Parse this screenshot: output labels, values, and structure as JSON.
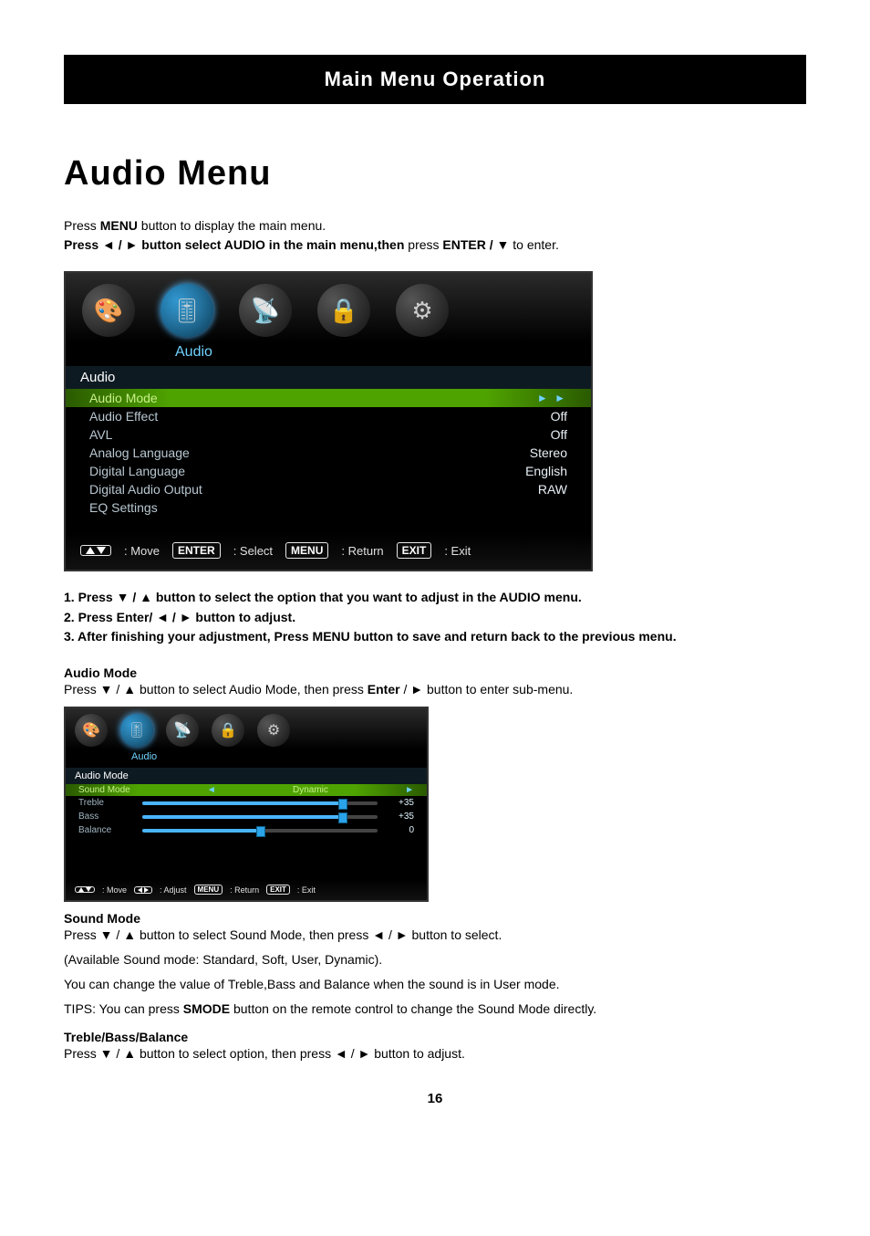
{
  "header": {
    "title": "Main Menu Operation"
  },
  "page_title": "Audio Menu",
  "intro": {
    "line1_pre": "Press ",
    "line1_bold1": "MENU",
    "line1_mid": " button  to display the main menu.",
    "line2_pre": "Press ◄ / ► button select ",
    "line2_bold1": "AUDIO",
    "line2_mid": " in the main menu,then ",
    "line2_plain": "press ",
    "line2_bold2": "ENTER / ▼",
    "line2_end": " to  enter."
  },
  "osd_large": {
    "tab_label": "Audio",
    "panel_title": "Audio",
    "rows": [
      {
        "label": "Audio Mode",
        "value": "",
        "highlight": true,
        "arrows": "► ►"
      },
      {
        "label": "Audio Effect",
        "value": "Off"
      },
      {
        "label": "AVL",
        "value": "Off"
      },
      {
        "label": "Analog Language",
        "value": "Stereo"
      },
      {
        "label": "Digital Language",
        "value": "English"
      },
      {
        "label": "Digital Audio Output",
        "value": "RAW"
      },
      {
        "label": "EQ Settings",
        "value": ""
      }
    ],
    "footer": {
      "move": ": Move",
      "enter_key": "ENTER",
      "enter_lbl": ": Select",
      "menu_key": "MENU",
      "menu_lbl": ": Return",
      "exit_key": "EXIT",
      "exit_lbl": ": Exit"
    }
  },
  "steps": {
    "s1": "1. Press ▼ / ▲ button to select the option that you want to adjust in the AUDIO menu.",
    "s2": "2. Press Enter/ ◄ / ► button to adjust.",
    "s3": "3. After finishing your adjustment, Press MENU button to save and return back to the previous menu."
  },
  "audio_mode": {
    "heading": "Audio Mode",
    "text_pre": "Press ▼ / ▲ button to select Audio Mode,  then press ",
    "text_bold": "Enter",
    "text_post": " / ► button to enter sub-menu."
  },
  "osd_small": {
    "tab_label": "Audio",
    "panel_title": "Audio Mode",
    "highlight_row": {
      "label": "Sound Mode",
      "value": "Dynamic"
    },
    "sliders": [
      {
        "label": "Treble",
        "value": "+35",
        "pct": "85%"
      },
      {
        "label": "Bass",
        "value": "+35",
        "pct": "85%"
      },
      {
        "label": "Balance",
        "value": "0",
        "pct": "50%"
      }
    ],
    "footer": {
      "move": ": Move",
      "adjust": ": Adjust",
      "menu_key": "MENU",
      "menu_lbl": ": Return",
      "exit_key": "EXIT",
      "exit_lbl": ": Exit"
    }
  },
  "sound_mode": {
    "heading": "Sound Mode",
    "l1": "Press ▼ / ▲ button to select Sound  Mode,  then press ◄ / ► button to select.",
    "l2": "(Available Sound mode: Standard, Soft, User, Dynamic).",
    "l3": "You can change the value of  Treble,Bass and Balance  when the sound is in User mode.",
    "l4_pre": "TIPS: You can press ",
    "l4_bold": "SMODE",
    "l4_post": " button on the remote control to change the Sound Mode directly."
  },
  "tbb": {
    "heading": "Treble/Bass/Balance",
    "text": "Press ▼ / ▲ button to select option, then press ◄ / ► button to adjust."
  },
  "page_number": "16",
  "icons": {
    "picture": "🎨",
    "audio": "🎚",
    "channel": "📡",
    "lock": "🔒",
    "setup": "⚙"
  }
}
